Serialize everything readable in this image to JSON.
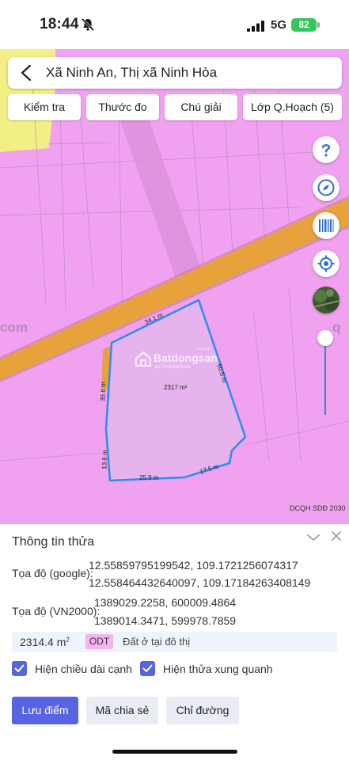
{
  "status_bar": {
    "time": "18:44",
    "network": "5G",
    "battery": "82",
    "icons": [
      "bell-slash-icon",
      "signal-icon"
    ]
  },
  "header": {
    "search_text": "Xã Ninh An, Thị xã Ninh Hòa",
    "icon": "back-arrow-icon"
  },
  "toolbar": {
    "check_label": "Kiểm tra",
    "measure_label": "Thước đo",
    "legend_label": "Chú giải",
    "layers_label": "Lớp Q.Hoạch (5)"
  },
  "map_controls": [
    "help-icon",
    "compass-icon",
    "barcode-icon",
    "locate-icon"
  ],
  "map": {
    "plan_code": "DCQH SDĐ 2030",
    "parcel_area": "2317 m²",
    "edge_labels": [
      "34.1 m",
      "50.5 m",
      "35.6 m",
      "13.6 m",
      "25.9 m",
      "17.5 m"
    ],
    "watermark": "Batdongsan",
    "watermark_sub": "by PropertyGuru",
    "watermark_tag": ".com.vn",
    "fragment_left": "com",
    "fragment_right": "q",
    "colors": {
      "residential": "#f0a2f0",
      "road": "#e8a23c",
      "yellow_zone": "#f2ef86",
      "highlight": "#2d8cf0"
    }
  },
  "panel": {
    "title": "Thông tin thửa",
    "google_label": "Tọa độ (google):",
    "google_1": "12.55859795199542, 109.1721256074317",
    "google_2": "12.558464432640097, 109.17184263408149",
    "vn2000_label": "Tọa độ (VN2000):",
    "vn2000_1": "1389029.2258, 600009.4864",
    "vn2000_2": "1389014.3471, 599978.7859",
    "area_value": "2314.4 m",
    "area_unit": "2",
    "land_code": "ODT",
    "land_use": "Đất ở tại đô thị",
    "show_lengths": "Hiện chiều dài cạnh",
    "show_neighbors": "Hiện thửa xung quanh",
    "save_point": "Lưu điểm",
    "share_code": "Mã chia sẻ",
    "directions": "Chỉ đường"
  }
}
